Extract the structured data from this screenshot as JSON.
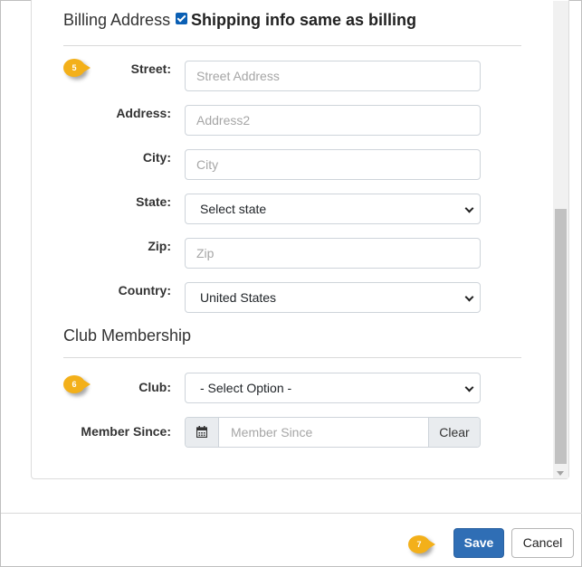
{
  "billing": {
    "title": "Billing Address",
    "same_as_billing_label": "Shipping info same as billing",
    "same_as_billing_checked": true,
    "street": {
      "label": "Street:",
      "value": "",
      "placeholder": "Street Address"
    },
    "address2": {
      "label": "Address:",
      "value": "",
      "placeholder": "Address2"
    },
    "city": {
      "label": "City:",
      "value": "",
      "placeholder": "City"
    },
    "state": {
      "label": "State:",
      "selected": "Select state"
    },
    "zip": {
      "label": "Zip:",
      "value": "",
      "placeholder": "Zip"
    },
    "country": {
      "label": "Country:",
      "selected": "United States"
    }
  },
  "club": {
    "title": "Club Membership",
    "club": {
      "label": "Club:",
      "selected": "- Select Option -"
    },
    "member_since": {
      "label": "Member Since:",
      "value": "",
      "placeholder": "Member Since",
      "clear_label": "Clear"
    }
  },
  "markers": {
    "m5": "5",
    "m6": "6",
    "m7": "7"
  },
  "footer": {
    "save_label": "Save",
    "cancel_label": "Cancel"
  },
  "colors": {
    "primary": "#2f6eb5",
    "marker": "#f3b01a",
    "checkbox": "#0a5fb4"
  },
  "icons": {
    "calendar": "calendar-icon",
    "chevron": "chevron-down-icon"
  }
}
